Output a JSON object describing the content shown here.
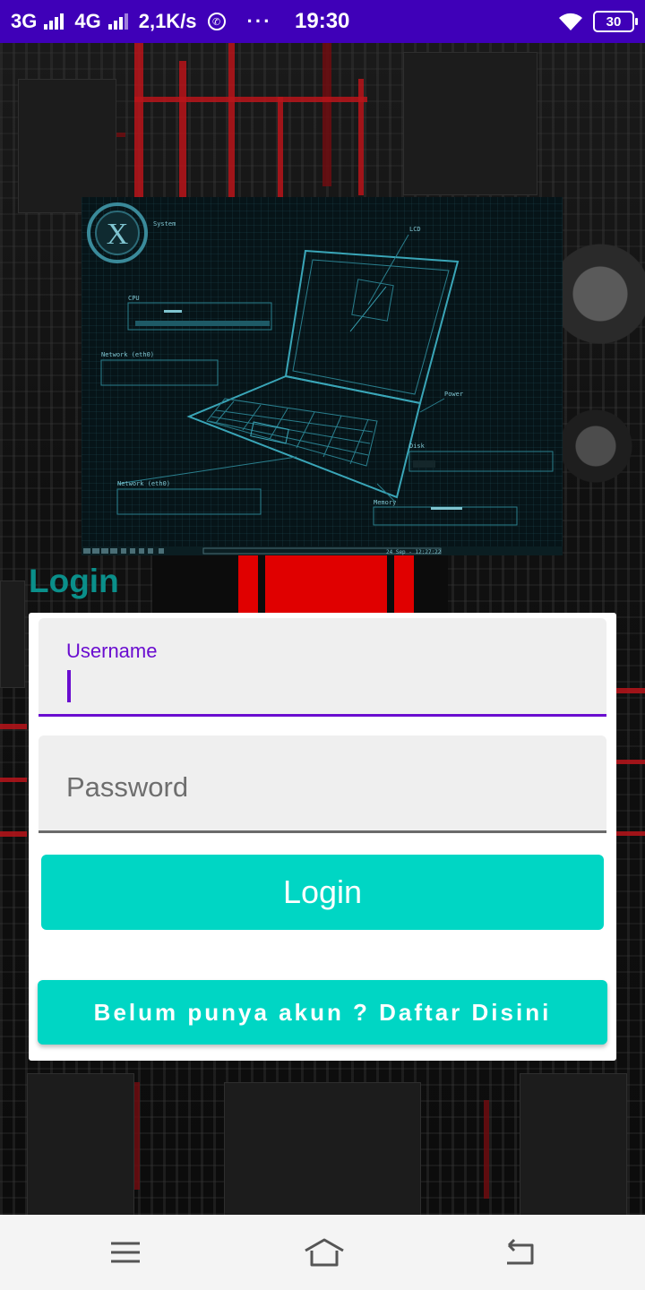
{
  "status_bar": {
    "network_1": "3G",
    "network_2": "4G",
    "speed": "2,1K/s",
    "more": "···",
    "time": "19:30",
    "battery": "30",
    "icons": [
      "signal-icon",
      "whatsapp-icon",
      "wifi-icon",
      "battery-icon"
    ]
  },
  "hero": {
    "panel_labels": {
      "system": "System",
      "cpu": "CPU",
      "network_1": "Network (eth0)",
      "network_2": "Network (eth0)",
      "memory": "Memory",
      "lcd": "LCD",
      "power": "Power",
      "disk": "Disk",
      "clock": "24 Sep - 12:27:22"
    }
  },
  "login": {
    "title": "Login",
    "username_label": "Username",
    "username_value": "",
    "password_placeholder": "Password",
    "password_value": "",
    "login_button": "Login",
    "register_button": "Belum punya akun ? Daftar Disini"
  },
  "colors": {
    "status_bar": "#3f00b8",
    "accent_purple": "#6a0dd0",
    "button_teal": "#00d6c4",
    "title_teal": "#0a8f8a"
  },
  "nav_bar": {
    "icons": [
      "menu-icon",
      "home-icon",
      "back-icon"
    ]
  }
}
